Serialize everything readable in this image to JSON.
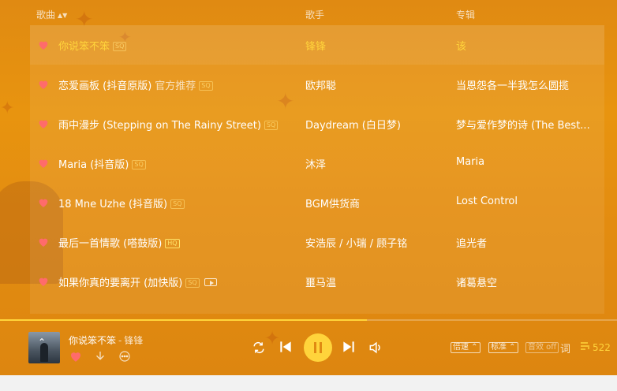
{
  "header": {
    "col_song": "歌曲",
    "col_artist": "歌手",
    "col_album": "专辑"
  },
  "songs": [
    {
      "title": "你说笨不笨",
      "sub": "",
      "badge": "SQ",
      "artist": "锋锋",
      "album": "该",
      "active": true
    },
    {
      "title": "恋爱画板 (抖音原版)",
      "sub": "官方推荐",
      "badge": "SQ",
      "artist": "欧邦聪",
      "album": "当恩怨各一半我怎么圆揽"
    },
    {
      "title": "雨中漫步 (Stepping on The Rainy Street)",
      "sub": "",
      "badge": "SQ",
      "artist": "Daydream (白日梦)",
      "album": "梦与爱作梦的诗 (The Best..."
    },
    {
      "title": "Maria (抖音版)",
      "sub": "",
      "badge": "SQ",
      "artist": "沐泽",
      "album": "Maria"
    },
    {
      "title": "18 Mne Uzhe (抖音版)",
      "sub": "",
      "badge": "SQ",
      "artist": "BGM供货商",
      "album": "Lost Control"
    },
    {
      "title": "最后一首情歌 (嗒鼓版)",
      "sub": "",
      "badge": "HQ",
      "artist": "安浩辰 / 小瑞 / 顾子铭",
      "album": "追光者"
    },
    {
      "title": "如果你真的要离开 (加快版)",
      "sub": "",
      "badge": "SQ",
      "artist": "噩马温",
      "album": "诸葛悬空"
    }
  ],
  "player": {
    "title": "你说笨不笨",
    "separator": "-",
    "artist": "锋锋",
    "progress_fraction": 0.595,
    "speed_label": "倍速",
    "quality_label": "标准",
    "effect_label": "音效 off",
    "lyrics_label": "词",
    "queue_count": "522"
  },
  "icons": {
    "favorite": "heart-icon",
    "download": "download-icon",
    "more": "more-icon",
    "loop": "loop-icon",
    "prev": "previous-icon",
    "pause": "pause-icon",
    "next": "next-icon",
    "volume": "volume-icon",
    "queue": "playlist-icon",
    "mv": "mv-icon"
  },
  "colors": {
    "accent": "#ffd43b",
    "heart": "#ff6b6b",
    "background": "#e38c10"
  }
}
